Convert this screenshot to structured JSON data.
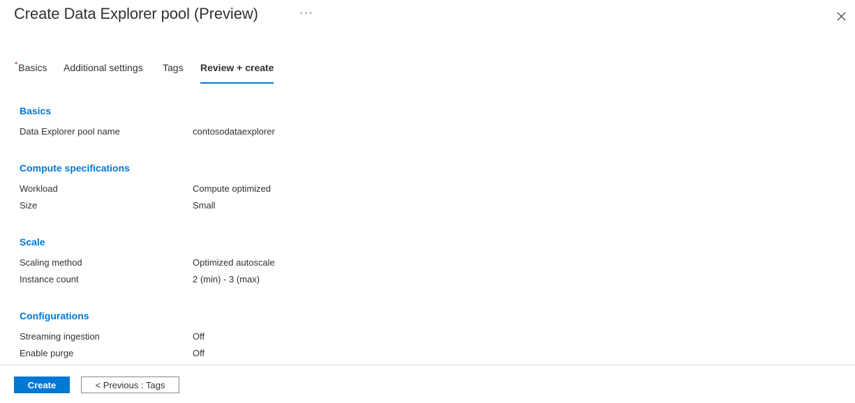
{
  "header": {
    "title": "Create Data Explorer pool (Preview)",
    "more_menu_label": "···",
    "close_icon": "close-icon"
  },
  "tabs": [
    {
      "id": "basics",
      "label": "Basics",
      "required": true,
      "active": false,
      "required_mark": "*"
    },
    {
      "id": "additional",
      "label": "Additional settings",
      "required": false,
      "active": false,
      "required_mark": ""
    },
    {
      "id": "tags",
      "label": "Tags",
      "required": false,
      "active": false,
      "required_mark": ""
    },
    {
      "id": "review",
      "label": "Review + create",
      "required": false,
      "active": true,
      "required_mark": ""
    }
  ],
  "sections": [
    {
      "id": "basics",
      "title": "Basics",
      "rows": [
        {
          "label": "Data Explorer pool name",
          "value": "contosodataexplorer"
        }
      ]
    },
    {
      "id": "compute",
      "title": "Compute specifications",
      "rows": [
        {
          "label": "Workload",
          "value": "Compute optimized"
        },
        {
          "label": "Size",
          "value": "Small"
        }
      ]
    },
    {
      "id": "scale",
      "title": "Scale",
      "rows": [
        {
          "label": "Scaling method",
          "value": "Optimized autoscale"
        },
        {
          "label": "Instance count",
          "value": "2 (min) - 3 (max)"
        }
      ]
    },
    {
      "id": "configurations",
      "title": "Configurations",
      "rows": [
        {
          "label": "Streaming ingestion",
          "value": "Off"
        },
        {
          "label": "Enable purge",
          "value": "Off"
        }
      ]
    }
  ],
  "footer": {
    "create_label": "Create",
    "previous_label": "< Previous : Tags"
  },
  "colors": {
    "accent": "#0078d4",
    "section_heading": "#0078d4",
    "required_asterisk": "#a4262c",
    "text": "#323130",
    "divider": "#e1dfdd",
    "button_border": "#8a8886"
  }
}
